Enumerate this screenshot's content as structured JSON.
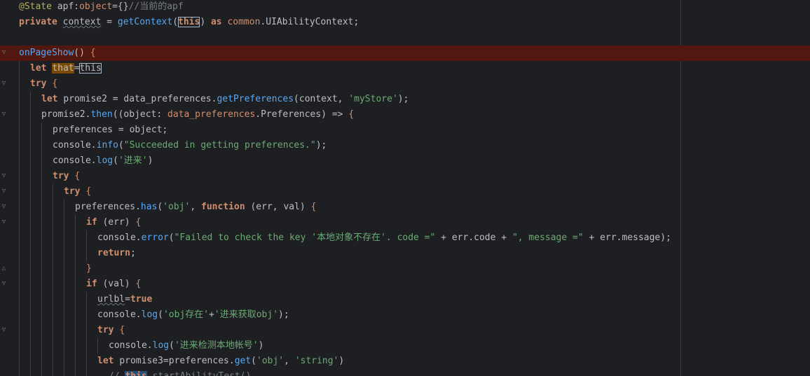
{
  "editor": {
    "lines": [
      {
        "segments": [
          {
            "t": "@State ",
            "c": "ann"
          },
          {
            "t": "apf",
            "c": ""
          },
          {
            "t": ":",
            "c": ""
          },
          {
            "t": "object",
            "c": "orange"
          },
          {
            "t": "={}",
            "c": ""
          },
          {
            "t": "//当前的apf",
            "c": "cmt"
          }
        ]
      },
      {
        "segments": [
          {
            "t": "private ",
            "c": "kw"
          },
          {
            "t": "context",
            "c": "wavy"
          },
          {
            "t": " = ",
            "c": ""
          },
          {
            "t": "getContext",
            "c": "fn"
          },
          {
            "t": "(",
            "c": ""
          },
          {
            "t": "this",
            "c": "kw box"
          },
          {
            "t": ") ",
            "c": ""
          },
          {
            "t": "as ",
            "c": "kw"
          },
          {
            "t": "common",
            "c": "orange"
          },
          {
            "t": ".UIAbilityContext;",
            "c": ""
          }
        ]
      },
      {
        "segments": []
      },
      {
        "segments": [
          {
            "t": "onPageShow",
            "c": "fn"
          },
          {
            "t": "() ",
            "c": ""
          },
          {
            "t": "{",
            "c": "orange"
          }
        ]
      },
      {
        "segments": [
          {
            "t": "let ",
            "c": "kw"
          },
          {
            "t": "that",
            "c": "hl-that"
          },
          {
            "t": "=",
            "c": ""
          },
          {
            "t": "this",
            "c": "box"
          }
        ]
      },
      {
        "segments": [
          {
            "t": "try ",
            "c": "kw"
          },
          {
            "t": "{",
            "c": "orange"
          }
        ]
      },
      {
        "segments": [
          {
            "t": "let ",
            "c": "kw"
          },
          {
            "t": "promise2 = data_preferences.",
            "c": ""
          },
          {
            "t": "getPreferences",
            "c": "fn"
          },
          {
            "t": "(context, ",
            "c": ""
          },
          {
            "t": "'myStore'",
            "c": "sq"
          },
          {
            "t": ");",
            "c": ""
          }
        ]
      },
      {
        "segments": [
          {
            "t": "promise2.",
            "c": ""
          },
          {
            "t": "then",
            "c": "fn"
          },
          {
            "t": "((object: ",
            "c": ""
          },
          {
            "t": "data_preferences",
            "c": "orange"
          },
          {
            "t": ".Preferences) => ",
            "c": ""
          },
          {
            "t": "{",
            "c": "orange"
          }
        ]
      },
      {
        "segments": [
          {
            "t": "preferences = object;",
            "c": ""
          }
        ]
      },
      {
        "segments": [
          {
            "t": "console.",
            "c": ""
          },
          {
            "t": "info",
            "c": "fn"
          },
          {
            "t": "(",
            "c": ""
          },
          {
            "t": "\"Succeeded in getting preferences.\"",
            "c": "dq-string"
          },
          {
            "t": ");",
            "c": ""
          }
        ]
      },
      {
        "segments": [
          {
            "t": "console.",
            "c": ""
          },
          {
            "t": "log",
            "c": "fn"
          },
          {
            "t": "(",
            "c": ""
          },
          {
            "t": "'进来'",
            "c": "sq"
          },
          {
            "t": ")",
            "c": ""
          }
        ]
      },
      {
        "segments": [
          {
            "t": "try ",
            "c": "kw"
          },
          {
            "t": "{",
            "c": "orange"
          }
        ]
      },
      {
        "segments": [
          {
            "t": "try ",
            "c": "kw"
          },
          {
            "t": "{",
            "c": "orange"
          }
        ]
      },
      {
        "segments": [
          {
            "t": "preferences.",
            "c": ""
          },
          {
            "t": "has",
            "c": "fn"
          },
          {
            "t": "(",
            "c": ""
          },
          {
            "t": "'obj'",
            "c": "sq"
          },
          {
            "t": ", ",
            "c": ""
          },
          {
            "t": "function ",
            "c": "kw"
          },
          {
            "t": "(err, val) ",
            "c": ""
          },
          {
            "t": "{",
            "c": "orange"
          }
        ]
      },
      {
        "segments": [
          {
            "t": "if ",
            "c": "kw"
          },
          {
            "t": "(err) ",
            "c": ""
          },
          {
            "t": "{",
            "c": "orange"
          }
        ]
      },
      {
        "segments": [
          {
            "t": "console.",
            "c": ""
          },
          {
            "t": "error",
            "c": "fn"
          },
          {
            "t": "(",
            "c": ""
          },
          {
            "t": "\"Failed to check the key '本地对象不存在'. code =\"",
            "c": "dq-string"
          },
          {
            "t": " + err.code + ",
            "c": ""
          },
          {
            "t": "\", message =\"",
            "c": "dq-string"
          },
          {
            "t": " + err.message);",
            "c": ""
          }
        ]
      },
      {
        "segments": [
          {
            "t": "return",
            "c": "kw"
          },
          {
            "t": ";",
            "c": ""
          }
        ]
      },
      {
        "segments": [
          {
            "t": "}",
            "c": "orange"
          }
        ]
      },
      {
        "segments": [
          {
            "t": "if ",
            "c": "kw"
          },
          {
            "t": "(val) ",
            "c": ""
          },
          {
            "t": "{",
            "c": "orange"
          }
        ]
      },
      {
        "segments": [
          {
            "t": "urlbl",
            "c": "wavy"
          },
          {
            "t": "=",
            "c": ""
          },
          {
            "t": "true",
            "c": "kw"
          }
        ]
      },
      {
        "segments": [
          {
            "t": "console.",
            "c": ""
          },
          {
            "t": "log",
            "c": "fn"
          },
          {
            "t": "(",
            "c": ""
          },
          {
            "t": "'obj存在'",
            "c": "sq"
          },
          {
            "t": "+",
            "c": ""
          },
          {
            "t": "'进来获取obj'",
            "c": "sq"
          },
          {
            "t": ");",
            "c": ""
          }
        ]
      },
      {
        "segments": [
          {
            "t": "try ",
            "c": "kw"
          },
          {
            "t": "{",
            "c": "orange"
          }
        ]
      },
      {
        "segments": [
          {
            "t": "console.",
            "c": ""
          },
          {
            "t": "log",
            "c": "fn"
          },
          {
            "t": "(",
            "c": ""
          },
          {
            "t": "'进来检测本地帐号'",
            "c": "sq"
          },
          {
            "t": ")",
            "c": ""
          }
        ]
      },
      {
        "segments": [
          {
            "t": "let ",
            "c": "kw"
          },
          {
            "t": "promise3=preferences.",
            "c": ""
          },
          {
            "t": "get",
            "c": "fn"
          },
          {
            "t": "(",
            "c": ""
          },
          {
            "t": "'obj'",
            "c": "sq"
          },
          {
            "t": ", ",
            "c": ""
          },
          {
            "t": "'string'",
            "c": "sq"
          },
          {
            "t": ")",
            "c": ""
          }
        ]
      },
      {
        "segments": [
          {
            "t": "// ",
            "c": "cmt"
          },
          {
            "t": "this",
            "c": "kw hl-this2"
          },
          {
            "t": ".startAbilityTest()",
            "c": "cmt"
          }
        ]
      }
    ]
  }
}
